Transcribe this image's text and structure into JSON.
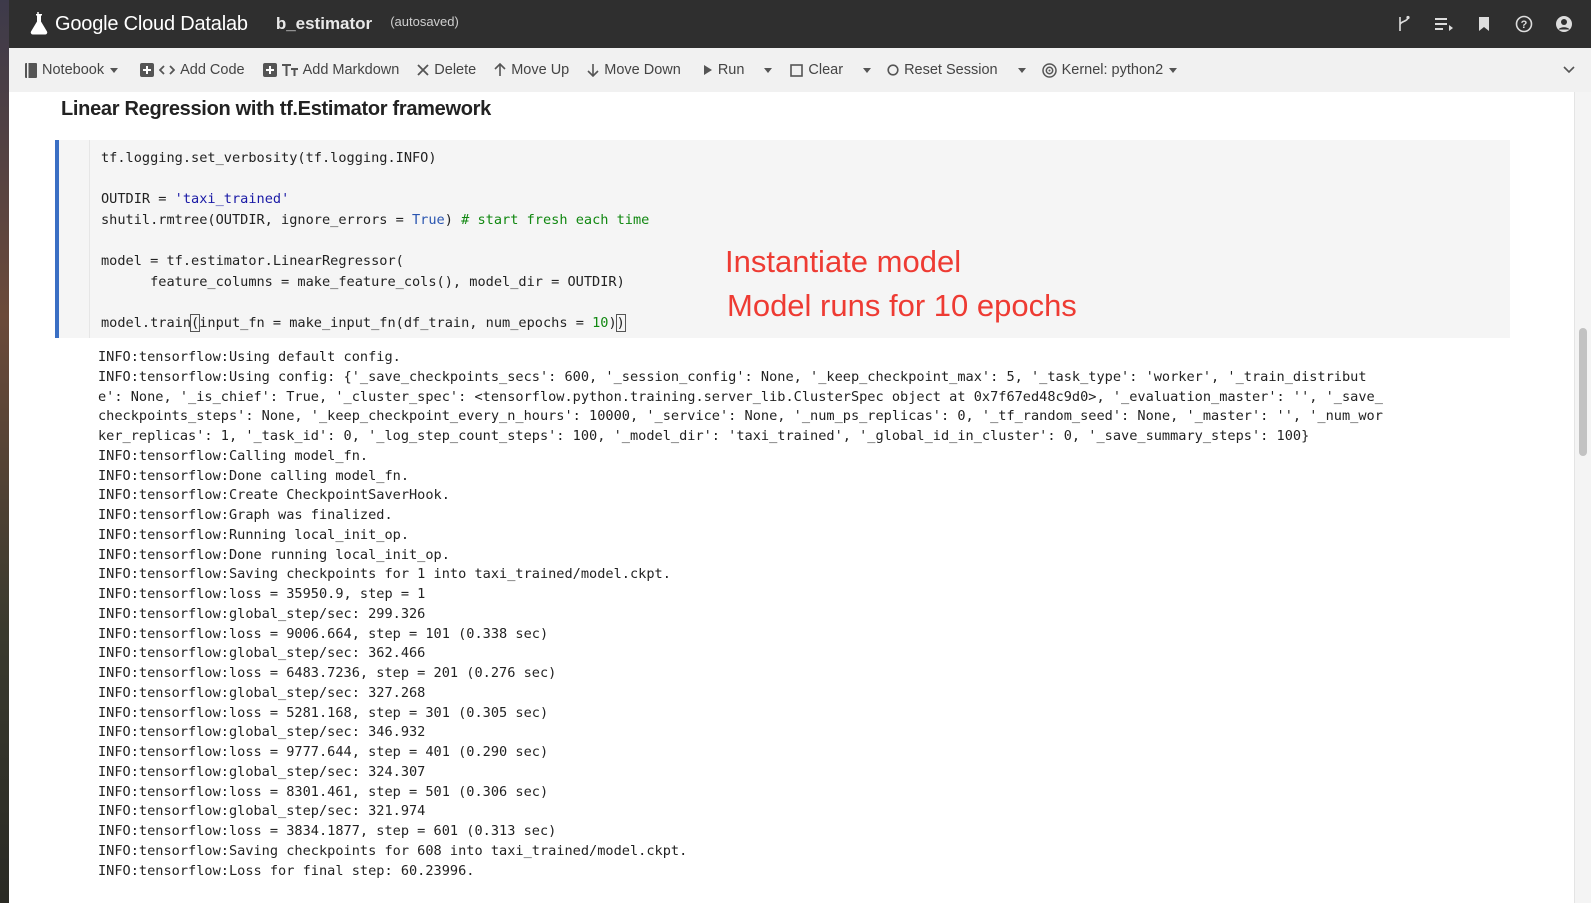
{
  "app": {
    "brand": "Google Cloud Datalab",
    "notebook_title": "b_estimator",
    "save_status": "(autosaved)",
    "right_icons": [
      "branch-icon",
      "list-icon",
      "bookmark-icon",
      "help-icon",
      "account-icon"
    ]
  },
  "toolbar": {
    "notebook": "Notebook",
    "add_code": "Add Code",
    "add_markdown": "Add Markdown",
    "delete": "Delete",
    "move_up": "Move Up",
    "move_down": "Move Down",
    "run": "Run",
    "clear": "Clear",
    "reset_session": "Reset Session",
    "kernel": "Kernel: python2"
  },
  "content": {
    "heading": "Linear Regression with tf.Estimator framework",
    "code_lines": [
      "tf.logging.set_verbosity(tf.logging.INFO)",
      "",
      "OUTDIR = 'taxi_trained'",
      "shutil.rmtree(OUTDIR, ignore_errors = True) # start fresh each time",
      "",
      "model = tf.estimator.LinearRegressor(",
      "      feature_columns = make_feature_cols(), model_dir = OUTDIR)",
      "",
      "model.train(input_fn = make_input_fn(df_train, num_epochs = 10))"
    ],
    "annotations": {
      "line1": "Instantiate model",
      "line2": "Model runs for 10 epochs"
    },
    "output_lines": [
      "INFO:tensorflow:Using default config.",
      "INFO:tensorflow:Using config: {'_save_checkpoints_secs': 600, '_session_config': None, '_keep_checkpoint_max': 5, '_task_type': 'worker', '_train_distribut",
      "e': None, '_is_chief': True, '_cluster_spec': <tensorflow.python.training.server_lib.ClusterSpec object at 0x7f67ed48c9d0>, '_evaluation_master': '', '_save_",
      "checkpoints_steps': None, '_keep_checkpoint_every_n_hours': 10000, '_service': None, '_num_ps_replicas': 0, '_tf_random_seed': None, '_master': '', '_num_wor",
      "ker_replicas': 1, '_task_id': 0, '_log_step_count_steps': 100, '_model_dir': 'taxi_trained', '_global_id_in_cluster': 0, '_save_summary_steps': 100}",
      "INFO:tensorflow:Calling model_fn.",
      "INFO:tensorflow:Done calling model_fn.",
      "INFO:tensorflow:Create CheckpointSaverHook.",
      "INFO:tensorflow:Graph was finalized.",
      "INFO:tensorflow:Running local_init_op.",
      "INFO:tensorflow:Done running local_init_op.",
      "INFO:tensorflow:Saving checkpoints for 1 into taxi_trained/model.ckpt.",
      "INFO:tensorflow:loss = 35950.9, step = 1",
      "INFO:tensorflow:global_step/sec: 299.326",
      "INFO:tensorflow:loss = 9006.664, step = 101 (0.338 sec)",
      "INFO:tensorflow:global_step/sec: 362.466",
      "INFO:tensorflow:loss = 6483.7236, step = 201 (0.276 sec)",
      "INFO:tensorflow:global_step/sec: 327.268",
      "INFO:tensorflow:loss = 5281.168, step = 301 (0.305 sec)",
      "INFO:tensorflow:global_step/sec: 346.932",
      "INFO:tensorflow:loss = 9777.644, step = 401 (0.290 sec)",
      "INFO:tensorflow:global_step/sec: 324.307",
      "INFO:tensorflow:loss = 8301.461, step = 501 (0.306 sec)",
      "INFO:tensorflow:global_step/sec: 321.974",
      "INFO:tensorflow:loss = 3834.1877, step = 601 (0.313 sec)",
      "INFO:tensorflow:Saving checkpoints for 608 into taxi_trained/model.ckpt.",
      "INFO:tensorflow:Loss for final step: 60.23996."
    ]
  },
  "colors": {
    "appbar": "#2f2f2f",
    "toolbar": "#f1f1f1",
    "cell_accent": "#3a6fc4",
    "annotation": "#ee3b33",
    "string_token": "#1a1aa6",
    "comment_token": "#118811"
  }
}
